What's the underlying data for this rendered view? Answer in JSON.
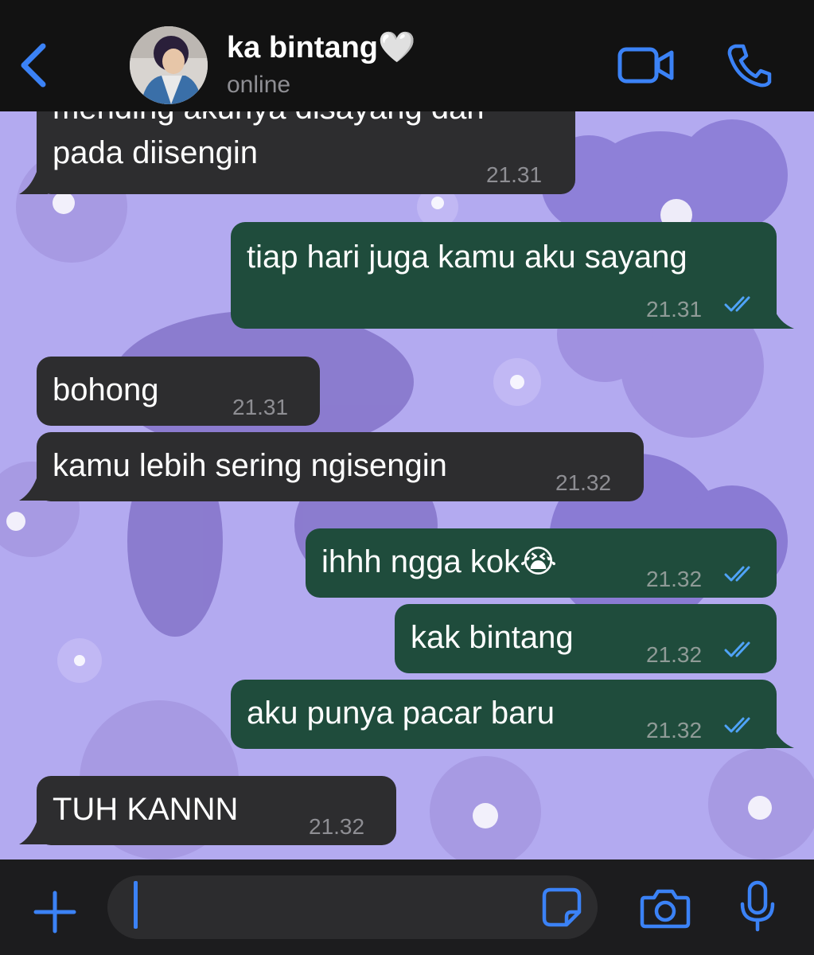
{
  "header": {
    "contact_name": "ka bintang🤍",
    "status": "online",
    "icons": [
      "back-chevron-icon",
      "avatar",
      "video-camera-icon",
      "phone-icon"
    ]
  },
  "messages": [
    {
      "id": "m1",
      "direction": "incoming",
      "text_line1": "mending akunya disayang dari",
      "text_line2": "pada diisengin",
      "time": "21.31"
    },
    {
      "id": "m2",
      "direction": "outgoing",
      "text": "tiap hari juga kamu aku sayang",
      "time": "21.31",
      "read": true
    },
    {
      "id": "m3",
      "direction": "incoming",
      "text": "bohong",
      "time": "21.31"
    },
    {
      "id": "m4",
      "direction": "incoming",
      "text": "kamu lebih sering ngisengin",
      "time": "21.32"
    },
    {
      "id": "m5",
      "direction": "outgoing",
      "text": "ihhh ngga kok😭",
      "time": "21.32",
      "read": true
    },
    {
      "id": "m6",
      "direction": "outgoing",
      "text": "kak bintang",
      "time": "21.32",
      "read": true
    },
    {
      "id": "m7",
      "direction": "outgoing",
      "text": "aku punya pacar baru",
      "time": "21.32",
      "read": true
    },
    {
      "id": "m8",
      "direction": "incoming",
      "text": "TUH KANNN",
      "time": "21.32"
    }
  ],
  "composer": {
    "value": "",
    "icons": [
      "plus-icon",
      "sticker-icon",
      "camera-icon",
      "microphone-icon"
    ]
  },
  "colors": {
    "accent": "#3b82f6",
    "incoming_bubble": "#2d2d2f",
    "outgoing_bubble": "#1f4c3c",
    "wallpaper": "#b3aaf0",
    "read_ticks": "#4fa3f7"
  }
}
